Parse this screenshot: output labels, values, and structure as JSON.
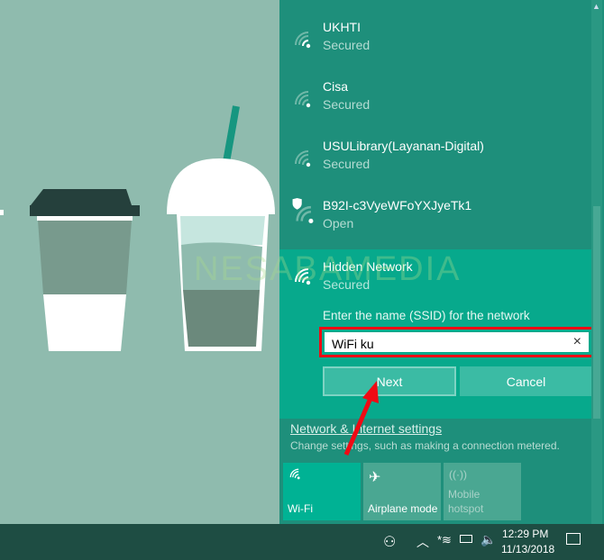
{
  "networks": [
    {
      "name": "UKHTI",
      "status": "Secured",
      "icon": "wifi-strong-icon"
    },
    {
      "name": "Cisa",
      "status": "Secured",
      "icon": "wifi-icon"
    },
    {
      "name": "USULibrary(Layanan-Digital)",
      "status": "Secured",
      "icon": "wifi-icon"
    },
    {
      "name": "B92I-c3VyeWFoYXJyeTk1",
      "status": "Open",
      "icon": "wifi-open-shield-icon"
    }
  ],
  "hidden": {
    "name": "Hidden Network",
    "status": "Secured",
    "prompt": "Enter the name (SSID) for the network",
    "ssid_value": "WiFi ku",
    "clear": "×",
    "next": "Next",
    "cancel": "Cancel"
  },
  "settings": {
    "link": "Network & Internet settings",
    "description": "Change settings, such as making a connection metered."
  },
  "tiles": [
    {
      "label": "Wi-Fi",
      "active": true
    },
    {
      "label": "Airplane mode",
      "active": false
    },
    {
      "label": "Mobile hotspot",
      "active": false,
      "disabled": true
    }
  ],
  "taskbar": {
    "time": "12:29 PM",
    "date": "11/13/2018"
  },
  "watermark": "NESABAMEDIA",
  "colors": {
    "panel": "#1e8f7b",
    "highlight": "#07a98c",
    "accent": "#00b294",
    "annotation": "#f00a14"
  }
}
